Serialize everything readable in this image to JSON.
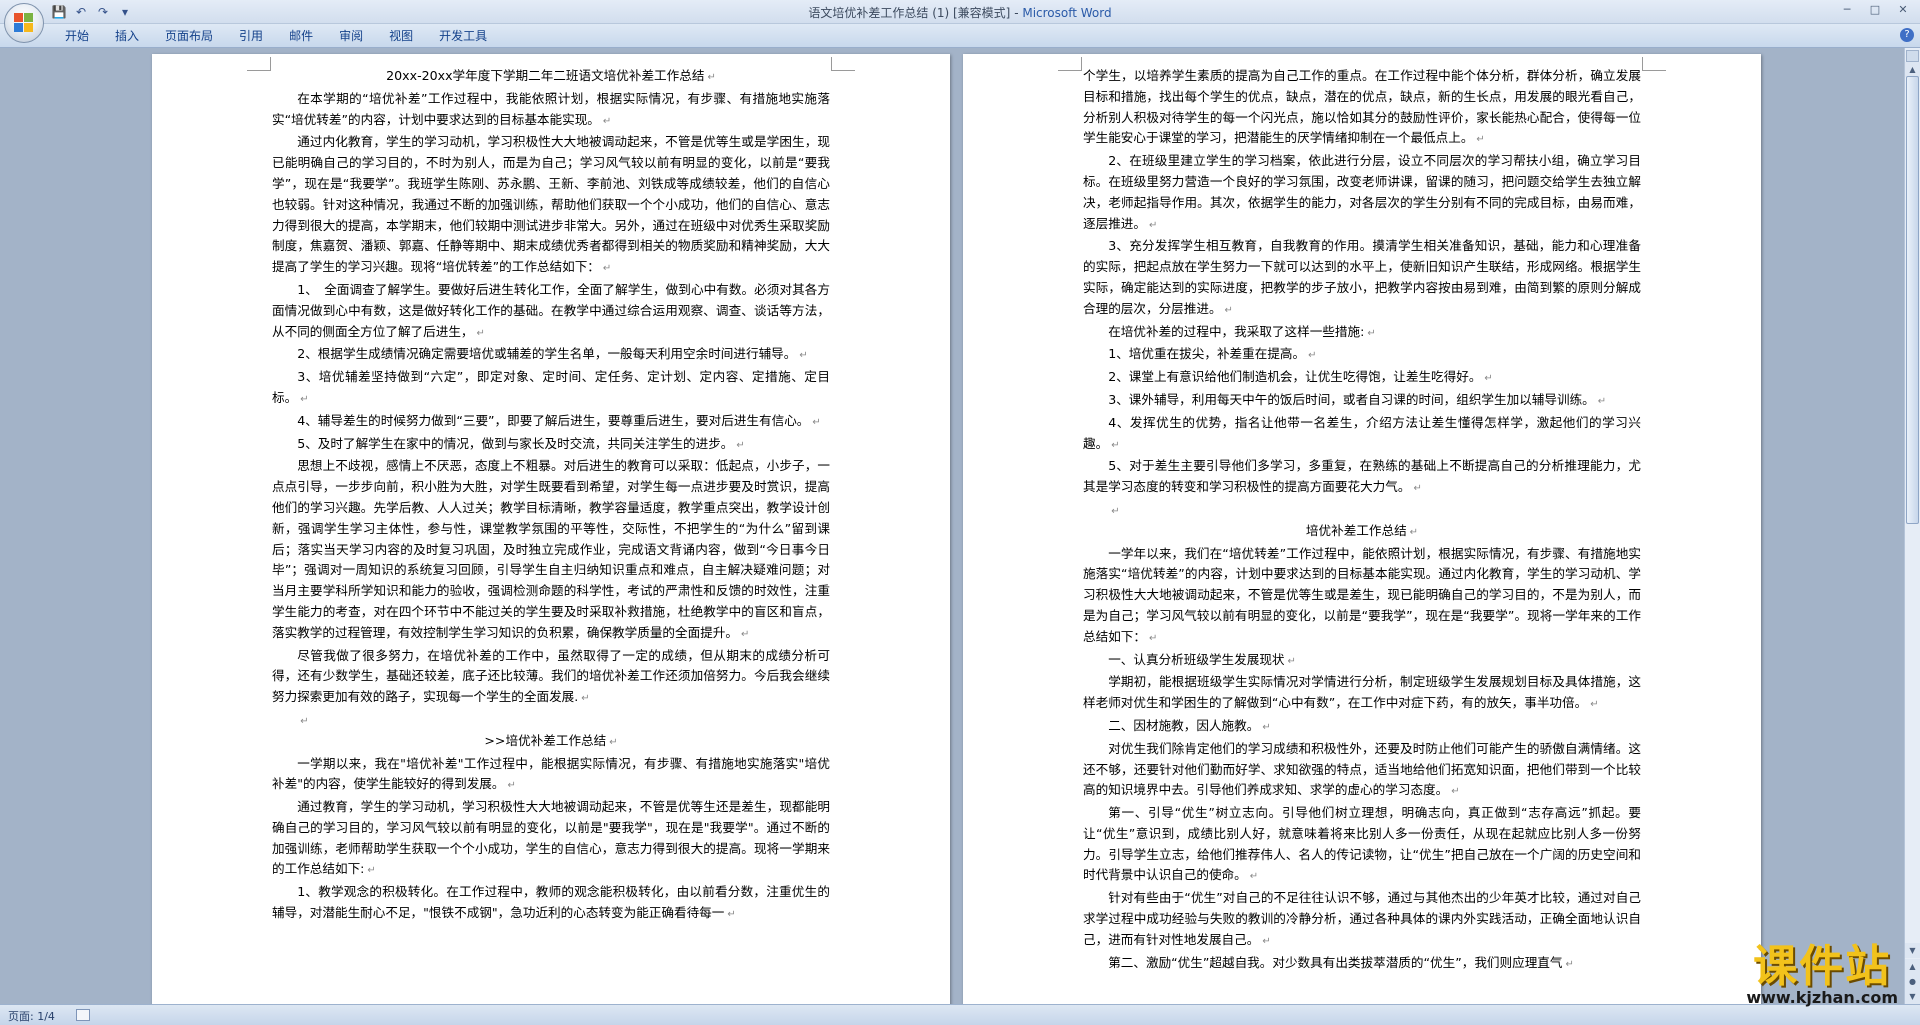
{
  "window": {
    "title_doc": "语文培优补差工作总结 (1) [兼容模式]",
    "title_sep": " - ",
    "title_app": "Microsoft Word",
    "qat_icons": [
      "save-icon",
      "undo-icon",
      "redo-icon",
      "customize-icon"
    ],
    "controls": [
      "minimize-icon",
      "maximize-icon",
      "close-icon"
    ]
  },
  "ribbon": {
    "tabs": [
      "开始",
      "插入",
      "页面布局",
      "引用",
      "邮件",
      "审阅",
      "视图",
      "开发工具"
    ],
    "help_label": "?"
  },
  "page_left": [
    {
      "t": "20xx-20xx学年度下学期二年二班语文培优补差工作总结",
      "style": "center"
    },
    {
      "t": "在本学期的“培优补差”工作过程中，我能依照计划，根据实际情况，有步骤、有措施地实施落实“培优转差”的内容，计划中要求达到的目标基本能实现。"
    },
    {
      "t": "通过内化教育，学生的学习动机，学习积极性大大地被调动起来，不管是优等生或是学困生，现已能明确自己的学习目的，不时为别人，而是为自己；学习风气较以前有明显的变化，以前是“要我学”，现在是“我要学”。我班学生陈刚、苏永鹏、王新、李前池、刘铁成等成绩较差，他们的自信心也较弱。针对这种情况，我通过不断的加强训练，帮助他们获取一个个小成功，他们的自信心、意志力得到很大的提高，本学期末，他们较期中测试进步非常大。另外，通过在班级中对优秀生采取奖励制度，焦嘉贺、潘颖、郭嘉、任静等期中、期末成绩优秀者都得到相关的物质奖励和精神奖励，大大提高了学生的学习兴趣。现将“培优转差”的工作总结如下："
    },
    {
      "t": "1、　全面调查了解学生。要做好后进生转化工作，全面了解学生，做到心中有数。必须对其各方面情况做到心中有数，这是做好转化工作的基础。在教学中通过综合运用观察、调查、谈话等方法，从不同的侧面全方位了解了后进生，"
    },
    {
      "t": "2、根据学生成绩情况确定需要培优或辅差的学生名单，一般每天利用空余时间进行辅导。"
    },
    {
      "t": "3、培优辅差坚持做到“六定”，即定对象、定时间、定任务、定计划、定内容、定措施、定目标。"
    },
    {
      "t": "4、辅导差生的时候努力做到“三要”，即要了解后进生，要尊重后进生，要对后进生有信心。"
    },
    {
      "t": "5、及时了解学生在家中的情况，做到与家长及时交流，共同关注学生的进步。"
    },
    {
      "t": "思想上不歧视，感情上不厌恶，态度上不粗暴。对后进生的教育可以采取：低起点，小步子，一点点引导，一步步向前，积小胜为大胜，对学生既要看到希望，对学生每一点进步要及时赏识，提高他们的学习兴趣。先学后教、人人过关；教学目标清晰，教学容量适度，教学重点突出，教学设计创新，强调学生学习主体性，参与性，课堂教学氛围的平等性，交际性，不把学生的“为什么”留到课后；落实当天学习内容的及时复习巩固，及时独立完成作业，完成语文背诵内容，做到“今日事今日毕”；强调对一周知识的系统复习回顾，引导学生自主归纳知识重点和难点，自主解决疑难问题；对当月主要学科所学知识和能力的验收，强调检测命题的科学性，考试的严肃性和反馈的时效性，注重学生能力的考查，对在四个环节中不能过关的学生要及时采取补救措施，杜绝教学中的盲区和盲点，落实教学的过程管理，有效控制学生学习知识的负积累，确保教学质量的全面提升。"
    },
    {
      "t": "尽管我做了很多努力，在培优补差的工作中，虽然取得了一定的成绩，但从期末的成绩分析可得，还有少数学生，基础还较差，底子还比较薄。我们的培优补差工作还须加倍努力。今后我会继续努力探索更加有效的路子，实现每一个学生的全面发展."
    },
    {
      "t": "",
      "style": "blank"
    },
    {
      "t": ">>培优补差工作总结",
      "style": "center"
    },
    {
      "t": "一学期以来，我在\"培优补差\"工作过程中，能根据实际情况，有步骤、有措施地实施落实\"培优补差\"的内容，使学生能较好的得到发展。"
    },
    {
      "t": "通过教育，学生的学习动机，学习积极性大大地被调动起来，不管是优等生还是差生，现都能明确自己的学习目的，学习风气较以前有明显的变化，以前是\"要我学\"，现在是\"我要学\"。通过不断的加强训练，老师帮助学生获取一个个小成功，学生的自信心，意志力得到很大的提高。现将一学期来的工作总结如下:"
    },
    {
      "t": "1、教学观念的积极转化。在工作过程中，教师的观念能积极转化，由以前看分数，注重优生的辅导，对潜能生耐心不足，\"恨铁不成钢\"，急功近利的心态转变为能正确看待每一"
    }
  ],
  "page_right": [
    {
      "t": "个学生，以培养学生素质的提高为自己工作的重点。在工作过程中能个体分析，群体分析，确立发展目标和措施，找出每个学生的优点，缺点，潜在的优点，缺点，新的生长点，用发展的眼光看自己，分析别人积极对待学生的每一个闪光点，施以恰如其分的鼓励性评价，家长能热心配合，使得每一位学生能安心于课堂的学习，把潜能生的厌学情绪抑制在一个最低点上。",
      "style": "noind"
    },
    {
      "t": "2、在班级里建立学生的学习档案，依此进行分层，设立不同层次的学习帮扶小组，确立学习目标。在班级里努力营造一个良好的学习氛围，改变老师讲课，留课的随习，把问题交给学生去独立解决，老师起指导作用。其次，依据学生的能力，对各层次的学生分别有不同的完成目标，由易而难，逐层推进。"
    },
    {
      "t": "3、充分发挥学生相互教育，自我教育的作用。摸清学生相关准备知识，基础，能力和心理准备的实际，把起点放在学生努力一下就可以达到的水平上，使新旧知识产生联结，形成网络。根据学生实际，确定能达到的实际进度，把教学的步子放小，把教学内容按由易到难，由简到繁的原则分解成合理的层次，分层推进。"
    },
    {
      "t": "在培优补差的过程中，我采取了这样一些措施:"
    },
    {
      "t": "1、培优重在拔尖，补差重在提高。"
    },
    {
      "t": "2、课堂上有意识给他们制造机会，让优生吃得饱，让差生吃得好。"
    },
    {
      "t": "3、课外辅导，利用每天中午的饭后时间，或者自习课的时间，组织学生加以辅导训练。"
    },
    {
      "t": "4、发挥优生的优势，指名让他带一名差生，介绍方法让差生懂得怎样学，激起他们的学习兴趣。"
    },
    {
      "t": "5、对于差生主要引导他们多学习，多重复，在熟练的基础上不断提高自己的分析推理能力，尤其是学习态度的转变和学习积极性的提高方面要花大力气。"
    },
    {
      "t": "",
      "style": "blank"
    },
    {
      "t": "培优补差工作总结",
      "style": "center"
    },
    {
      "t": "一学年以来，我们在“培优转差”工作过程中，能依照计划，根据实际情况，有步骤、有措施地实施落实“培优转差”的内容，计划中要求达到的目标基本能实现。通过内化教育，学生的学习动机、学习积极性大大地被调动起来，不管是优等生或是差生，现已能明确自己的学习目的，不是为别人，而是为自己；学习风气较以前有明显的变化，以前是“要我学”，现在是“我要学”。现将一学年来的工作总结如下："
    },
    {
      "t": "一、认真分析班级学生发展现状"
    },
    {
      "t": "学期初，能根据班级学生实际情况对学情进行分析，制定班级学生发展规划目标及具体措施，这样老师对优生和学困生的了解做到“心中有数”，在工作中对症下药，有的放矢，事半功倍。"
    },
    {
      "t": "二、因材施教，因人施教。"
    },
    {
      "t": "对优生我们除肯定他们的学习成绩和积极性外，还要及时防止他们可能产生的骄傲自满情绪。这还不够，还要针对他们勤而好学、求知欲强的特点，适当地给他们拓宽知识面，把他们带到一个比较高的知识境界中去。引导他们养成求知、求学的虚心的学习态度。"
    },
    {
      "t": "第一、引导“优生”树立志向。引导他们树立理想，明确志向，真正做到“志存高远”抓起。要让“优生”意识到，成绩比别人好，就意味着将来比别人多一份责任，从现在起就应比别人多一份努力。引导学生立志，给他们推荐伟人、名人的传记读物，让“优生”把自己放在一个广阔的历史空间和时代背景中认识自己的使命。"
    },
    {
      "t": "针对有些由于“优生”对自己的不足往往认识不够，通过与其他杰出的少年英才比较，通过对自己求学过程中成功经验与失败的教训的冷静分析，通过各种具体的课内外实践活动，正确全面地认识自己，进而有针对性地发展自己。"
    },
    {
      "t": "第二、激励“优生”超越自我。对少数具有出类拔萃潜质的“优生”，我们则应理直气"
    }
  ],
  "status": {
    "page_label": "页面: 1/4"
  },
  "watermark": {
    "text": "课件站",
    "url": "www.kjzhan.com"
  },
  "colors": {
    "app_title": "#2a5aa8",
    "ribbon_tab_text": "#15428b",
    "workspace": "#a3b3c8",
    "watermark": "#f2c21b"
  }
}
